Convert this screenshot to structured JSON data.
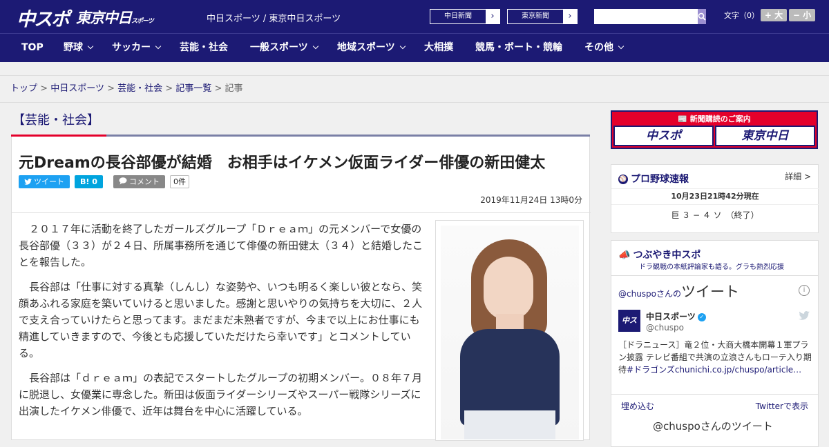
{
  "header": {
    "logo_primary": "中スポ",
    "logo_secondary": "東京中日",
    "logo_secondary_small": "スポーツ",
    "site_name": "中日スポーツ / 東京中日スポーツ",
    "ext_links": [
      {
        "label": "中日新聞",
        "arrow": "›"
      },
      {
        "label": "東京新聞",
        "arrow": "›"
      }
    ],
    "search_placeholder": "",
    "font_label": "文字（0）",
    "font_larger": "+ 大",
    "font_smaller": "− 小"
  },
  "nav": {
    "items": [
      "TOP",
      "野球",
      "サッカー",
      "芸能・社会",
      "一般スポーツ",
      "地域スポーツ",
      "大相撲",
      "競馬・ボート・競輪",
      "その他"
    ]
  },
  "breadcrumb": {
    "items": [
      "トップ",
      "中日スポーツ",
      "芸能・社会",
      "記事一覧"
    ],
    "current": "記事",
    "separator": ">"
  },
  "article": {
    "category": "【芸能・社会】",
    "headline": "元Dreamの長谷部優が結婚　お相手はイケメン仮面ライダー俳優の新田健太",
    "share": {
      "tweet": "ツイート",
      "hatena": "B! 0",
      "comment": "コメント",
      "count": "0件"
    },
    "date": "2019年11月24日 13時0分",
    "paragraphs": [
      "２０１７年に活動を終了したガールズグループ「Ｄｒｅａｍ」の元メンバーで女優の長谷部優（３３）が２４日、所属事務所を通じて俳優の新田健太（３４）と結婚したことを報告した。",
      "長谷部は「仕事に対する真摯（しんし）な姿勢や、いつも明るく楽しい彼となら、笑顔あふれる家庭を築いていけると思いました。感謝と思いやりの気持ちを大切に、２人で支え合っていけたらと思ってます。まだまだ未熟者ですが、今まで以上にお仕事にも精進していきますので、今後とも応援していただけたら幸いです」とコメントしている。",
      "長谷部は「ｄｒｅａｍ」の表記でスタートしたグループの初期メンバー。０８年７月に脱退し、女優業に専念した。新田は仮面ライダーシリーズやスーパー戦隊シリーズに出演したイケメン俳優で、近年は舞台を中心に活躍している。"
    ]
  },
  "sidebar": {
    "ad": {
      "title": "新聞購読のご案内",
      "btn1": "中スポ",
      "btn2": "東京中日"
    },
    "baseball": {
      "title": "プロ野球速報",
      "detail": "詳細 >",
      "as_of": "10月23日21時42分現在",
      "score": "巨 ３ − ４ ソ　（終了）"
    },
    "twitter": {
      "title": "つぶやき中スポ",
      "subtitle": "ドラ観戦の本紙評論家も語る。グラも熱烈応援",
      "heading_prefix": "@chuspoさんの",
      "heading": "ツイート",
      "avatar_text": "中スポ",
      "name": "中日スポーツ",
      "handle": "@chuspo",
      "tweet_text": "［ドラニュース］竜２位・大商大橋本開幕１軍プラン披露 テレビ番組で共演の立浪さんもローテ入り期待",
      "tweet_link": "#ドラゴンズchunichi.co.jp/chuspo/article…",
      "embed": "埋め込む",
      "view": "Twitterで表示",
      "next_heading": "@chuspoさんのツイート"
    }
  },
  "colors": {
    "brand": "#1c1a74",
    "accent": "#e4002b",
    "twitter": "#1da1f2"
  }
}
